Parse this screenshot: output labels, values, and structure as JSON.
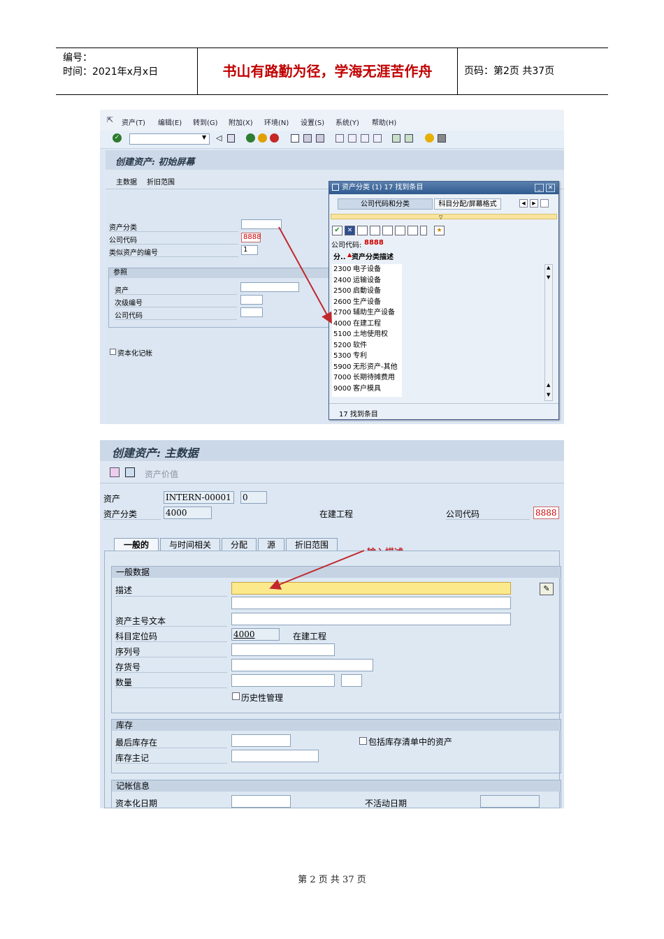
{
  "header": {
    "number_label": "编号：",
    "time_label": "时间：2021年x月x日",
    "motto": "书山有路勤为径，学海无涯苦作舟",
    "page_info": "页码：第2页  共37页"
  },
  "footer": {
    "text": "第 2 页 共 37 页"
  },
  "screen1": {
    "menu": [
      "资产(T)",
      "编辑(E)",
      "转到(G)",
      "附加(X)",
      "环境(N)",
      "设置(S)",
      "系统(Y)",
      "帮助(H)"
    ],
    "title": "创建资产: 初始屏幕",
    "app_buttons": [
      "主数据",
      "折旧范围"
    ],
    "fields": {
      "asset_class_label": "资产分类",
      "company_code_label": "公司代码",
      "company_code_value": "8888",
      "similar_count_label": "类似资产的编号",
      "similar_count_value": "1"
    },
    "reference": {
      "header": "参照",
      "asset_label": "资产",
      "sub_number_label": "次级编号",
      "company_code_label": "公司代码"
    },
    "capitalize_label": "资本化记帐",
    "popup": {
      "title": "资产分类 (1)  17 找到条目",
      "tab1": "公司代码和分类",
      "tab2": "科目分配/屏幕格式",
      "company_code_line_label": "公司代码:",
      "company_code_line_value": "8888",
      "col1": "分..",
      "col2": "资产分类描述",
      "rows": [
        {
          "code": "2300",
          "desc": "电子设备"
        },
        {
          "code": "2400",
          "desc": "运输设备"
        },
        {
          "code": "2500",
          "desc": "启動设备"
        },
        {
          "code": "2600",
          "desc": "生产设备"
        },
        {
          "code": "2700",
          "desc": "辅助生产设备"
        },
        {
          "code": "4000",
          "desc": "在建工程"
        },
        {
          "code": "5100",
          "desc": "土地使用权"
        },
        {
          "code": "5200",
          "desc": "软件"
        },
        {
          "code": "5300",
          "desc": "专利"
        },
        {
          "code": "5900",
          "desc": "无形资产-其他"
        },
        {
          "code": "7000",
          "desc": "长期待摊费用"
        },
        {
          "code": "9000",
          "desc": "客户模具"
        }
      ],
      "status": "17 找到条目"
    }
  },
  "screen2": {
    "title": "创建资产: 主数据",
    "asset_value_button": "资产价值",
    "asset_label": "资产",
    "asset_value": "INTERN-00001",
    "asset_sub_value": "0",
    "asset_class_label": "资产分类",
    "asset_class_value": "4000",
    "asset_class_desc": "在建工程",
    "company_code_label": "公司代码",
    "company_code_value": "8888",
    "tabs": [
      "一般的",
      "与时间相关",
      "分配",
      "源",
      "折旧范围"
    ],
    "annotation": "输入描述",
    "general": {
      "header": "一般数据",
      "desc_label": "描述",
      "main_text_label": "资产主号文本",
      "account_label": "科目定位码",
      "account_value": "4000",
      "account_desc": "在建工程",
      "serial_label": "序列号",
      "inventory_label": "存货号",
      "quantity_label": "数量",
      "history_label": "历史性管理"
    },
    "stock": {
      "header": "库存",
      "last_label": "最后库存在",
      "include_label": "包括库存清单中的资产",
      "note_label": "库存主记"
    },
    "posting": {
      "header": "记帐信息",
      "cap_date_label": "资本化日期",
      "inactive_label": "不活动日期"
    }
  },
  "colors": {
    "motto": "#c00000",
    "annotation_arrow": "#c0282d",
    "highlight_field": "#fce98c",
    "code_red": "#cc0000"
  }
}
